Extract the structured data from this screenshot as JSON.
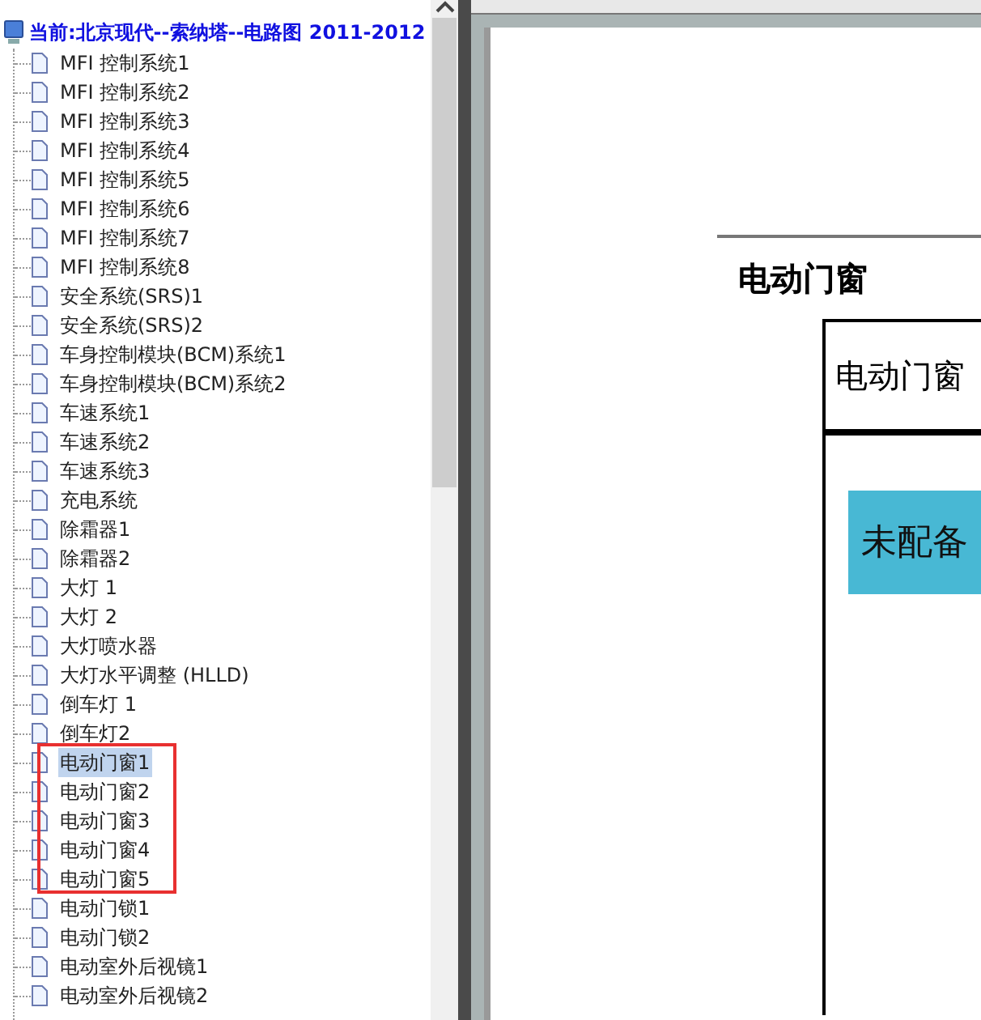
{
  "tree": {
    "title": "当前:北京现代--索纳塔--电路图 2011-2012",
    "items": [
      {
        "label": "MFI 控制系统1",
        "selected": false
      },
      {
        "label": "MFI 控制系统2",
        "selected": false
      },
      {
        "label": "MFI 控制系统3",
        "selected": false
      },
      {
        "label": "MFI 控制系统4",
        "selected": false
      },
      {
        "label": "MFI 控制系统5",
        "selected": false
      },
      {
        "label": "MFI 控制系统6",
        "selected": false
      },
      {
        "label": "MFI 控制系统7",
        "selected": false
      },
      {
        "label": "MFI 控制系统8",
        "selected": false
      },
      {
        "label": "安全系统(SRS)1",
        "selected": false
      },
      {
        "label": "安全系统(SRS)2",
        "selected": false
      },
      {
        "label": "车身控制模块(BCM)系统1",
        "selected": false
      },
      {
        "label": "车身控制模块(BCM)系统2",
        "selected": false
      },
      {
        "label": "车速系统1",
        "selected": false
      },
      {
        "label": "车速系统2",
        "selected": false
      },
      {
        "label": "车速系统3",
        "selected": false
      },
      {
        "label": "充电系统",
        "selected": false
      },
      {
        "label": "除霜器1",
        "selected": false
      },
      {
        "label": "除霜器2",
        "selected": false
      },
      {
        "label": "大灯 1",
        "selected": false
      },
      {
        "label": "大灯 2",
        "selected": false
      },
      {
        "label": "大灯喷水器",
        "selected": false
      },
      {
        "label": "大灯水平调整 (HLLD)",
        "selected": false
      },
      {
        "label": "倒车灯 1",
        "selected": false
      },
      {
        "label": "倒车灯2",
        "selected": false
      },
      {
        "label": "电动门窗1",
        "selected": true
      },
      {
        "label": "电动门窗2",
        "selected": false
      },
      {
        "label": "电动门窗3",
        "selected": false
      },
      {
        "label": "电动门窗4",
        "selected": false
      },
      {
        "label": "电动门窗5",
        "selected": false
      },
      {
        "label": "电动门锁1",
        "selected": false
      },
      {
        "label": "电动门锁2",
        "selected": false
      },
      {
        "label": "电动室外后视镜1",
        "selected": false
      },
      {
        "label": "电动室外后视镜2",
        "selected": false
      }
    ]
  },
  "document": {
    "heading": "电动门窗",
    "table_header": "电动门窗",
    "badge": "未配备"
  }
}
